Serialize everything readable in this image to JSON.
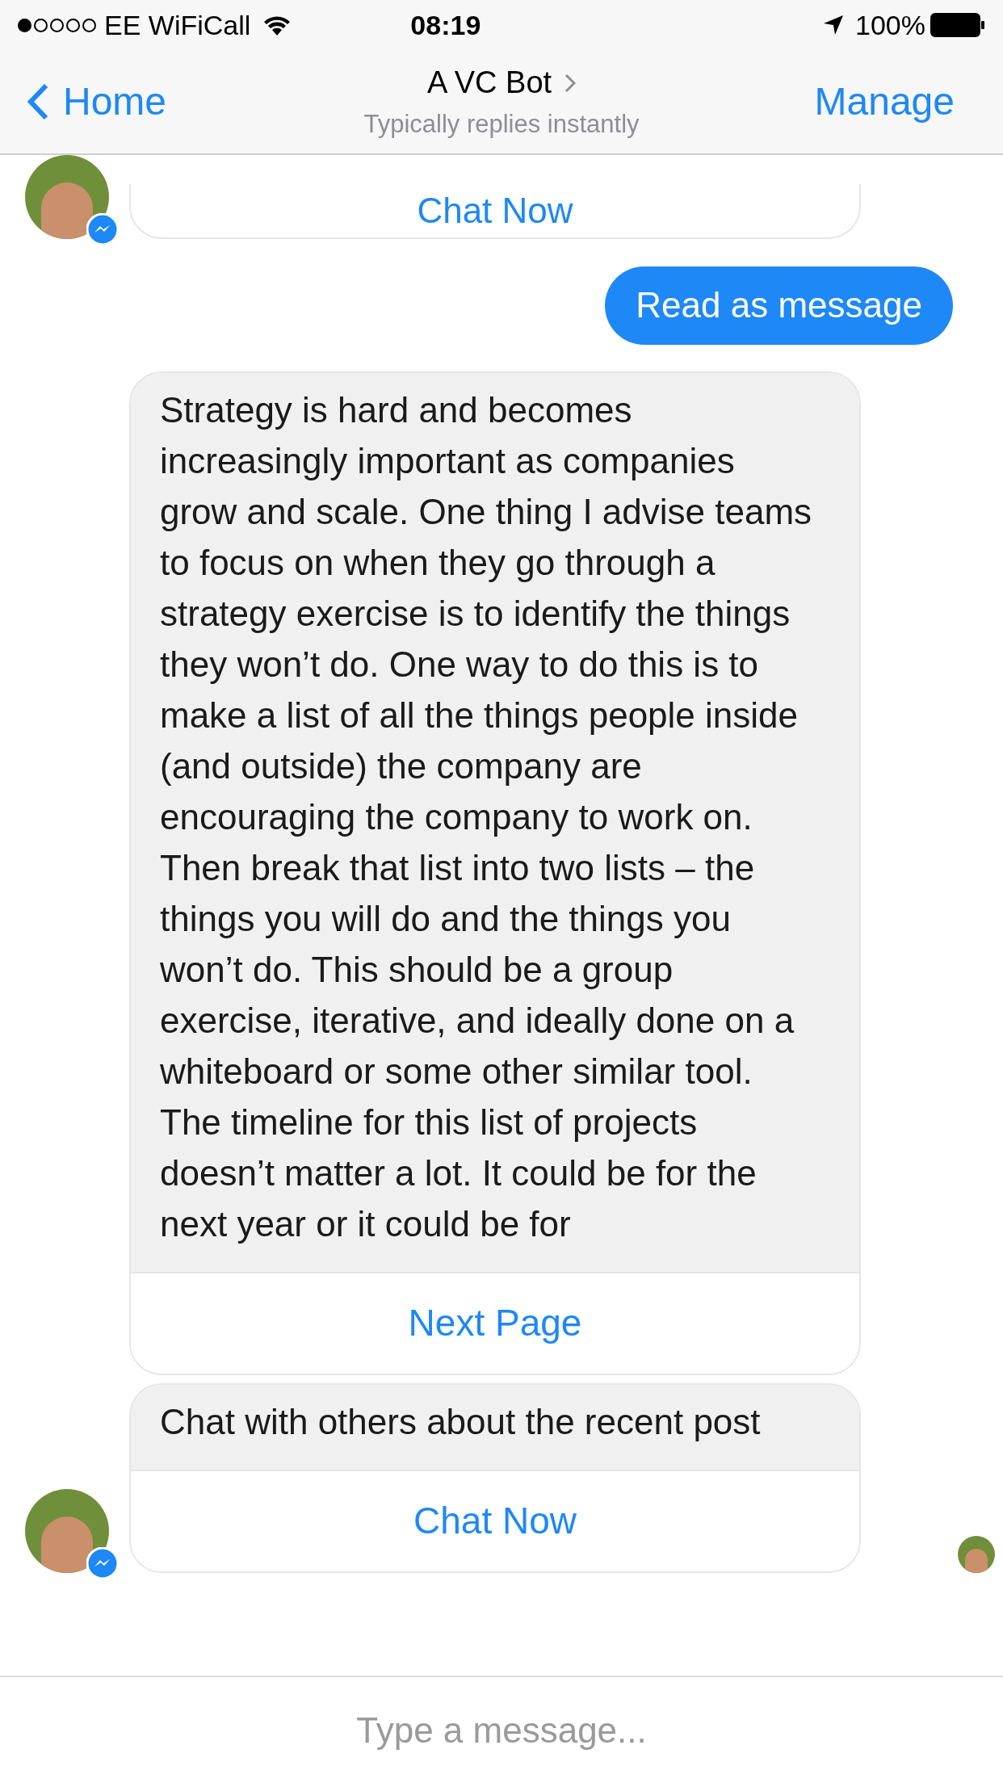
{
  "status_bar": {
    "carrier": "EE WiFiCall",
    "time": "08:19",
    "battery": "100%"
  },
  "nav": {
    "back": "Home",
    "title": "A VC Bot",
    "subtitle": "Typically replies instantly",
    "action": "Manage"
  },
  "messages": [
    {
      "kind": "card_tail",
      "button": "Chat Now",
      "avatar": true
    },
    {
      "kind": "outgoing",
      "text": "Read as message"
    },
    {
      "kind": "card",
      "text": "Strategy is hard and becomes increasingly important as companies grow and scale. One thing I advise teams to focus on when they go through a strategy exercise is to identify the things they won’t do. One way to do this is to make a list of all the things people inside (and outside) the company are encouraging the company to work on. Then break that list into two lists – the things you will do and the things you won’t do. This should be a group exercise, iterative, and ideally done on a whiteboard or some other similar tool. The timeline for this list of projects doesn’t matter a lot. It could be for the next year or it could be for",
      "button": "Next Page",
      "avatar": false
    },
    {
      "kind": "card",
      "text": "Chat with others about the recent post",
      "button": "Chat Now",
      "avatar": true,
      "read_receipt": true
    }
  ],
  "composer": {
    "placeholder": "Type a message..."
  }
}
